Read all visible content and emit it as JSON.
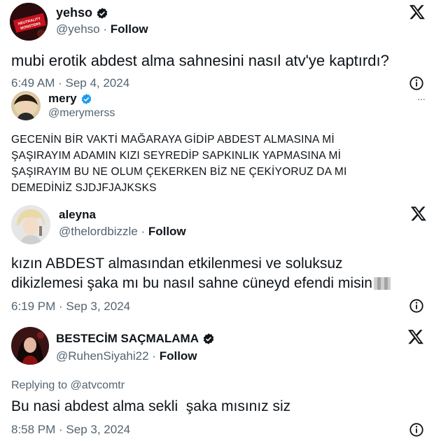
{
  "tweets": [
    {
      "name": "yehso",
      "handle": "@yehso",
      "follow": "Follow",
      "verified": true,
      "text": "mubi erotik abdest alma sahnesini nasıl atv'ye kaptırdı?",
      "time": "6:49 AM · Sep 4, 2024",
      "avatar_text": "NEUTRALITY MONSTERS"
    },
    {
      "name": "mery",
      "handle": "@merymerss",
      "verified": true,
      "lines": [
        "GECENİN BİR VAKTİ MAĞARAYA GİDİP ABDEST ALMASINA Mİ",
        "ŞAŞIRAYIM ADAMIN KIZI SEYREDİP SAPKINLIK YAPMASINA Mİ",
        "ŞAŞIRAYIM BU NE OLUM ÇEKERKEN BİZ NE ÇEKİYORUZ DA MI",
        "DEMEDİNİZ SJDJFJAJKSKS"
      ],
      "more": "···"
    },
    {
      "name": "aleyna",
      "handle": "@thelordbizzle",
      "follow": "Follow",
      "verified": false,
      "lines": [
        "kızın ABDEST almasından etkilenmesi ve soluksuz",
        "dikizlemesi şaka mı bu nasıl sahne cüneyd efendi misin"
      ],
      "time": "6:19 PM · Sep 3, 2024"
    },
    {
      "name": "BESTECİM SAÇMALAMA",
      "handle": "@RuhenSiyahi22",
      "follow": "Follow",
      "verified": true,
      "replying": "Replying to @atvcomtr",
      "text": "Bu nasi abdest alma sekli  şaka mısınız siz",
      "time": "8:58 PM · Sep 3, 2024"
    }
  ],
  "colors": {
    "text": "#0f1419",
    "secondary": "#536471",
    "verified_blue": "#1d9bf0",
    "verified_black": "#0f1419"
  },
  "icons": [
    "x-logo-icon",
    "info-icon",
    "verified-badge-icon",
    "more-icon"
  ]
}
